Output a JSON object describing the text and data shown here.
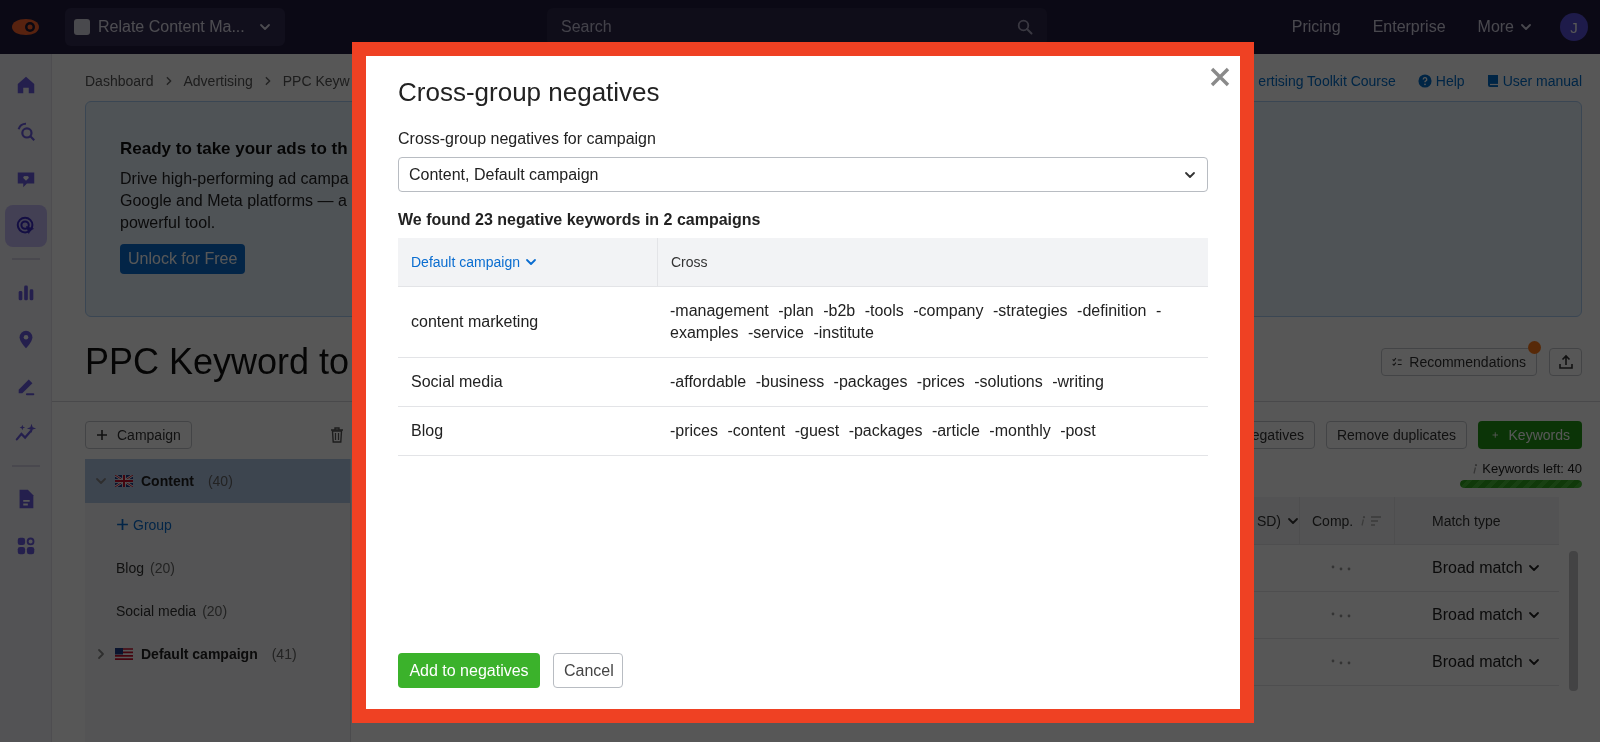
{
  "top_bar": {
    "project": "Relate Content Ma...",
    "search_placeholder": "Search",
    "nav": [
      {
        "label": "Pricing",
        "menu": false
      },
      {
        "label": "Enterprise",
        "menu": false
      },
      {
        "label": "More",
        "menu": true
      }
    ],
    "avatar": "J"
  },
  "sidebar": {
    "groups": [
      [
        {
          "selected": false
        },
        {
          "selected": false
        },
        {
          "selected": false
        },
        {
          "selected": true
        }
      ],
      [
        {
          "selected": false
        },
        {
          "selected": false
        },
        {
          "selected": false
        },
        {
          "selected": false
        }
      ],
      [
        {
          "selected": false
        },
        {
          "selected": false
        }
      ]
    ]
  },
  "breadcrumb": [
    "Dashboard",
    "Advertising",
    "PPC Keyw"
  ],
  "header_links": [
    {
      "label": "ertising Toolkit Course",
      "kind": "plain"
    },
    {
      "label": "Help",
      "kind": "help"
    },
    {
      "label": "User manual",
      "kind": "manual"
    }
  ],
  "banner": {
    "title": "Ready to take your ads to th",
    "description_lines": [
      "Drive high-performing ad campa",
      "Google and Meta platforms — a",
      "powerful tool."
    ],
    "button": "Unlock for Free"
  },
  "page_title": "PPC Keyword to",
  "page_actions": {
    "recommendations": "Recommendations",
    "has_notification": true
  },
  "toolbar": {
    "campaign_button": "Campaign",
    "right_buttons": [
      {
        "label": "egatives",
        "kind": "outline"
      },
      {
        "label": "Remove duplicates",
        "kind": "outline"
      },
      {
        "label": "Keywords",
        "kind": "primary"
      }
    ]
  },
  "keywords_left": {
    "label": "Keywords left: 40",
    "level": 1
  },
  "campaigns": [
    {
      "name": "Content",
      "count": "(40)",
      "kind": "british",
      "expanded": true,
      "selected": true,
      "add_group": "Group",
      "children": [
        {
          "name": "Blog",
          "count": "(20)"
        },
        {
          "name": "Social media",
          "count": "(20)"
        }
      ]
    },
    {
      "name": "Default campaign",
      "count": "(41)",
      "kind": "american",
      "expanded": false,
      "selected": false
    }
  ],
  "keyword_table": {
    "columns": [
      "SD)",
      "Comp.",
      "Match type"
    ],
    "rows": [
      {
        "match": "Broad match"
      },
      {
        "match": "Broad match"
      },
      {
        "match": "Broad match"
      }
    ]
  },
  "dialog": {
    "title": "Cross-group negatives",
    "field_label": "Cross-group negatives for campaign",
    "select_value": "Content, Default campaign",
    "summary": "We found 23 negative keywords in 2 campaigns",
    "columns": [
      {
        "label": "Default campaign",
        "sortable": true
      },
      {
        "label": "Cross",
        "sortable": false
      }
    ],
    "rows": [
      {
        "group": "content marketing",
        "negatives": "-management -plan -b2b -tools -company -strategies -definition -examples -service -institute"
      },
      {
        "group": "Social media",
        "negatives": "-affordable -business -packages -prices -solutions -writing"
      },
      {
        "group": "Blog",
        "negatives": "-prices -content -guest -packages -article -monthly -post"
      }
    ],
    "buttons": [
      {
        "label": "Add to negatives",
        "kind": "primary"
      },
      {
        "label": "Cancel",
        "kind": "secondary"
      }
    ]
  }
}
